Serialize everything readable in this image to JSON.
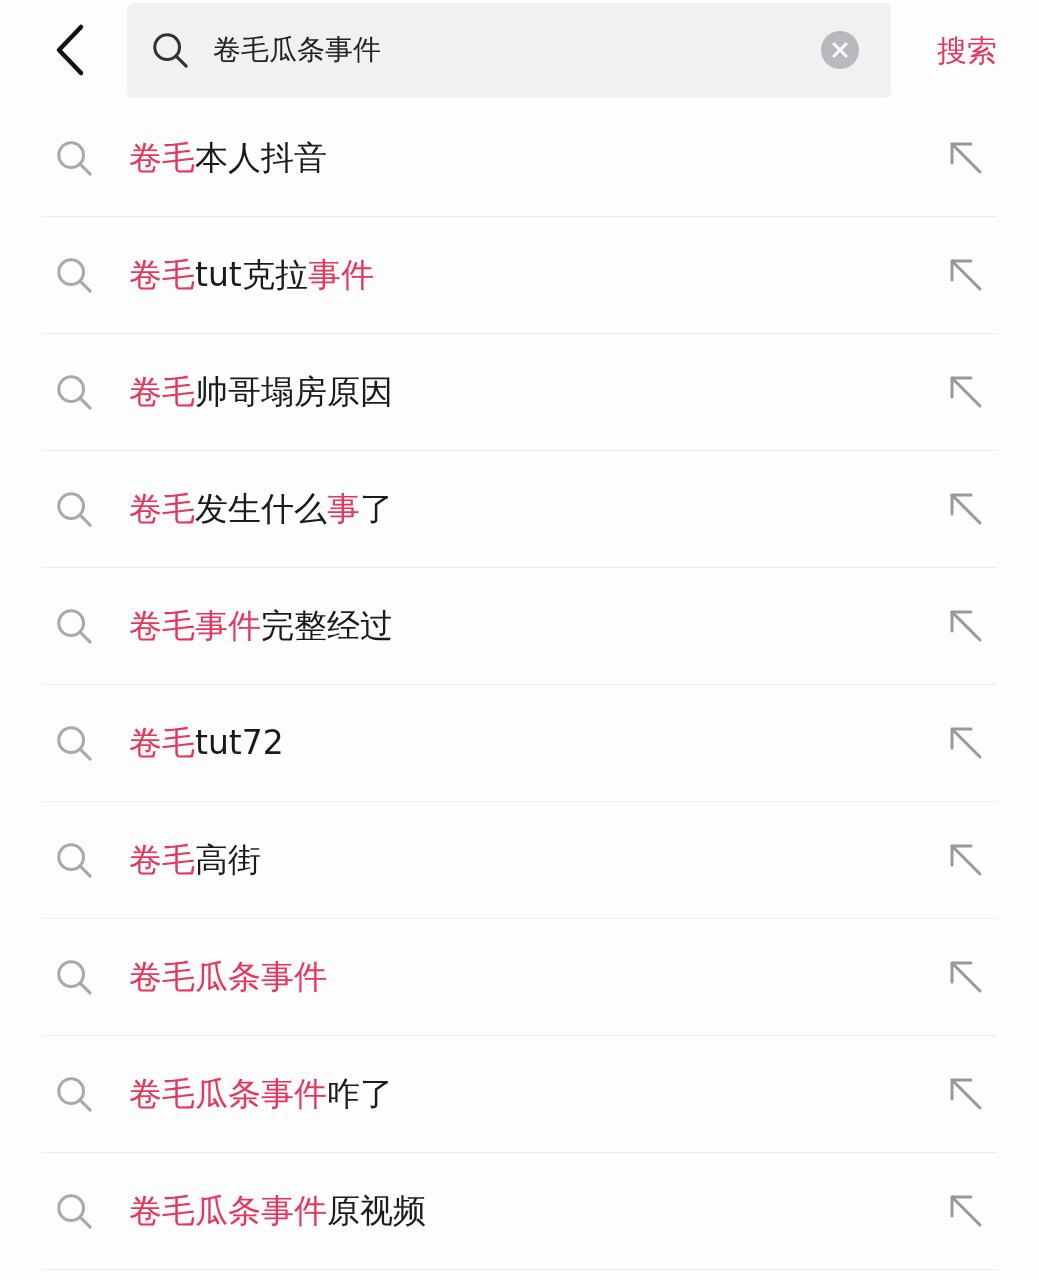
{
  "search": {
    "value": "卷毛瓜条事件",
    "action": "搜索"
  },
  "suggestions": [
    {
      "segments": [
        {
          "text": "卷毛",
          "highlighted": true
        },
        {
          "text": "本人抖音",
          "highlighted": false
        }
      ]
    },
    {
      "segments": [
        {
          "text": "卷毛",
          "highlighted": true
        },
        {
          "text": "tut克拉",
          "highlighted": false
        },
        {
          "text": "事件",
          "highlighted": true
        }
      ]
    },
    {
      "segments": [
        {
          "text": "卷毛",
          "highlighted": true
        },
        {
          "text": "帅哥塌房原因",
          "highlighted": false
        }
      ]
    },
    {
      "segments": [
        {
          "text": "卷毛",
          "highlighted": true
        },
        {
          "text": "发生什么",
          "highlighted": false
        },
        {
          "text": "事",
          "highlighted": true
        },
        {
          "text": "了",
          "highlighted": false
        }
      ]
    },
    {
      "segments": [
        {
          "text": "卷毛事件",
          "highlighted": true
        },
        {
          "text": "完整经过",
          "highlighted": false
        }
      ]
    },
    {
      "segments": [
        {
          "text": "卷毛",
          "highlighted": true
        },
        {
          "text": "tut72",
          "highlighted": false
        }
      ]
    },
    {
      "segments": [
        {
          "text": "卷毛",
          "highlighted": true
        },
        {
          "text": "高街",
          "highlighted": false
        }
      ]
    },
    {
      "segments": [
        {
          "text": "卷毛瓜条事件",
          "highlighted": true
        }
      ]
    },
    {
      "segments": [
        {
          "text": "卷毛瓜条事件",
          "highlighted": true
        },
        {
          "text": "咋了",
          "highlighted": false
        }
      ]
    },
    {
      "segments": [
        {
          "text": "卷毛瓜条事件",
          "highlighted": true
        },
        {
          "text": "原视频",
          "highlighted": false
        }
      ]
    }
  ]
}
